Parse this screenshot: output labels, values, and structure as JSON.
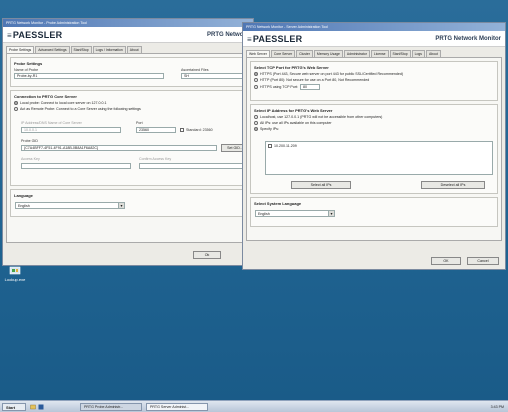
{
  "left_window": {
    "title": "PRTG Network Monitor - Probe Administration Tool",
    "brand": "PAESSLER",
    "product": "PRTG Network",
    "tabs": [
      "Probe Settings",
      "Advanced Settings",
      "Start/Stop",
      "Logs / Information",
      "About"
    ],
    "probe_settings": {
      "title": "Probe Settings",
      "name_label": "Name of Probe",
      "name_value": "Probe-by-R1",
      "gid_label": "Ascertained Files",
      "gid_value": "SH"
    },
    "connection": {
      "title": "Connection to PRTG Core Server",
      "option_local": "Local probe: Connect to local core server on 127.0.0.1",
      "option_remote": "Act as Remote Probe: Connect to a Core Server using the following settings",
      "server_label": "IP Address/DNS Name of Core Server",
      "server_value": "10.0.0.1",
      "port_label": "Port",
      "port_value": "23560",
      "default_label": "Standard: 23560",
      "gid_label": "Probe GID",
      "gid_value": "{C7A4BFF7-4F51-4F91-A18B-0B8A1F6A82C}",
      "gid_button": "Set GID...",
      "access_label": "Access Key",
      "confirm_label": "Confirm Access Key"
    },
    "language": {
      "title": "Language",
      "value": "English"
    },
    "ok_button": "Ok"
  },
  "right_window": {
    "title": "PRTG Network Monitor - Server Administration Tool",
    "brand": "PAESSLER",
    "product": "PRTG Network Monitor",
    "tabs": [
      "Web Server",
      "Core Server",
      "Cluster",
      "Memory Usage",
      "Administrator",
      "License",
      "Start/Stop",
      "Logs",
      "About"
    ],
    "ssl_group": {
      "title": "Select TCP Port for PRTG's Web Server",
      "option_https": "HTTPS (Port 443, Secure web server on port 443 for public SSL/Certified Recommended)",
      "option_http": "HTTP (Port 80): Not secure for use on a Port 80, Not Recommended",
      "option_custom": "HTTPS using TCP Port:",
      "custom_port": "80"
    },
    "ip_group": {
      "title": "Select IP Address for PRTG's Web Server",
      "option_localhost": "Localhost, use 127.0.0.1 (PRTG will not be accessible from other computers)",
      "option_all": "All IPs: use all IPs available on this computer",
      "option_specify": "Specify IPs:",
      "ip_list": [
        "10.200.11.209"
      ],
      "add_button": "Select all IPs",
      "remove_button": "Deselect all IPs"
    },
    "language_group": {
      "title": "Select System Language",
      "value": "English"
    },
    "ok_button": "OK",
    "cancel_button": "Cancel"
  },
  "desktop": {
    "icon_label": "Lookup.exe"
  },
  "taskbar": {
    "start": "Start",
    "tasks": [
      "PRTG Probe Administr...",
      "PRTG Server Administ..."
    ],
    "clock": "3:43 PM"
  }
}
